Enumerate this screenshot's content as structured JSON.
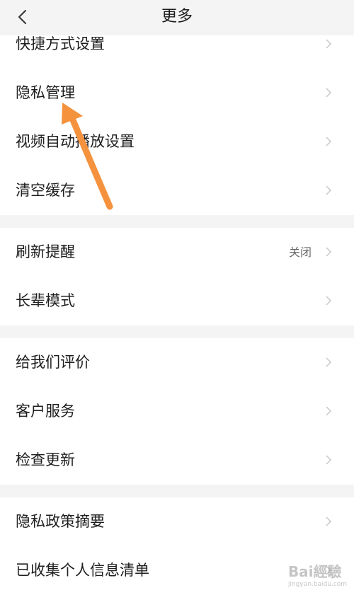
{
  "header": {
    "title": "更多",
    "back_icon": "chevron-left-icon"
  },
  "groups": [
    {
      "items": [
        {
          "label": "快捷方式设置",
          "value": ""
        },
        {
          "label": "隐私管理",
          "value": ""
        },
        {
          "label": "视频自动播放设置",
          "value": ""
        },
        {
          "label": "清空缓存",
          "value": ""
        }
      ]
    },
    {
      "items": [
        {
          "label": "刷新提醒",
          "value": "关闭"
        },
        {
          "label": "长辈模式",
          "value": ""
        }
      ]
    },
    {
      "items": [
        {
          "label": "给我们评价",
          "value": ""
        },
        {
          "label": "客户服务",
          "value": ""
        },
        {
          "label": "检查更新",
          "value": ""
        }
      ]
    },
    {
      "items": [
        {
          "label": "隐私政策摘要",
          "value": ""
        },
        {
          "label": "已收集个人信息清单",
          "value": ""
        }
      ]
    }
  ],
  "watermark": {
    "main": "Bai經驗",
    "sub": "jingyan.baidu.com"
  },
  "colors": {
    "annotation_arrow": "#f5923e",
    "background": "#f4f4f4",
    "row_background": "#ffffff"
  }
}
